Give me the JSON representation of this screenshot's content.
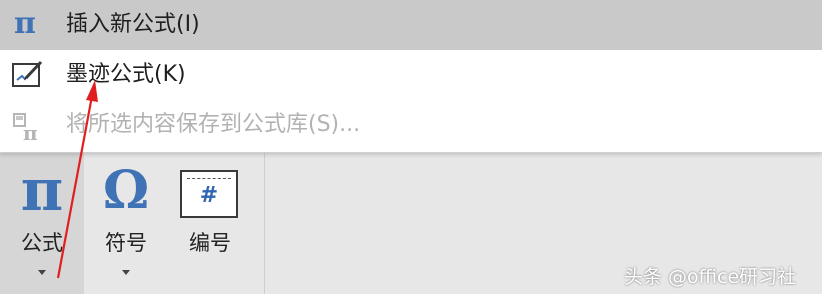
{
  "menu": {
    "items": [
      {
        "label": "插入新公式(I)",
        "icon": "pi-icon",
        "state": "highlighted"
      },
      {
        "label": "墨迹公式(K)",
        "icon": "ink-equation-icon",
        "state": "normal"
      },
      {
        "label": "将所选内容保存到公式库(S)...",
        "icon": "save-to-gallery-icon",
        "state": "disabled"
      }
    ]
  },
  "ribbon": {
    "equation": {
      "label": "公式",
      "icon": "pi-icon"
    },
    "symbol": {
      "label": "符号",
      "icon": "omega-icon"
    },
    "numbering": {
      "label": "编号",
      "icon": "numbering-icon"
    }
  },
  "watermark": {
    "text": "头条 @office研习社"
  },
  "colors": {
    "accent": "#3f73b5",
    "highlight": "#c9c9c9",
    "arrow": "#e02020"
  }
}
